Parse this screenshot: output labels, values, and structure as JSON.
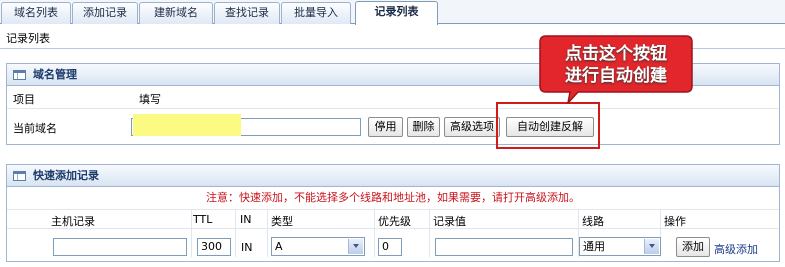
{
  "tabs": [
    {
      "label": "域名列表",
      "active": false
    },
    {
      "label": "添加记录",
      "active": false
    },
    {
      "label": "建新域名",
      "active": false
    },
    {
      "label": "查找记录",
      "active": false
    },
    {
      "label": "批量导入",
      "active": false
    },
    {
      "label": "记录列表",
      "active": true
    }
  ],
  "page_title": "记录列表",
  "domain_panel": {
    "title": "域名管理",
    "col_item": "项目",
    "col_fill": "填写",
    "row_label": "当前域名",
    "domain_value": "",
    "buttons": {
      "disable": "停用",
      "delete": "删除",
      "advanced": "高级选项",
      "auto_reverse": "自动创建反解"
    }
  },
  "callout": {
    "line1": "点击这个按钮",
    "line2": "进行自动创建",
    "fill_color": "#e3262b"
  },
  "quick_panel": {
    "title": "快速添加记录",
    "notice": "注意：快速添加，不能选择多个线路和地址池，如果需要，请打开高级添加。",
    "headers": [
      "主机记录",
      "TTL",
      "IN",
      "类型",
      "优先级",
      "记录值",
      "线路",
      "操作"
    ],
    "host_value": "",
    "ttl_value": "300",
    "in_value": "IN",
    "type_value": "A",
    "priority_value": "0",
    "record_value": "",
    "line_value": "通用",
    "add_button": "添加",
    "advanced_link": "高级添加"
  }
}
